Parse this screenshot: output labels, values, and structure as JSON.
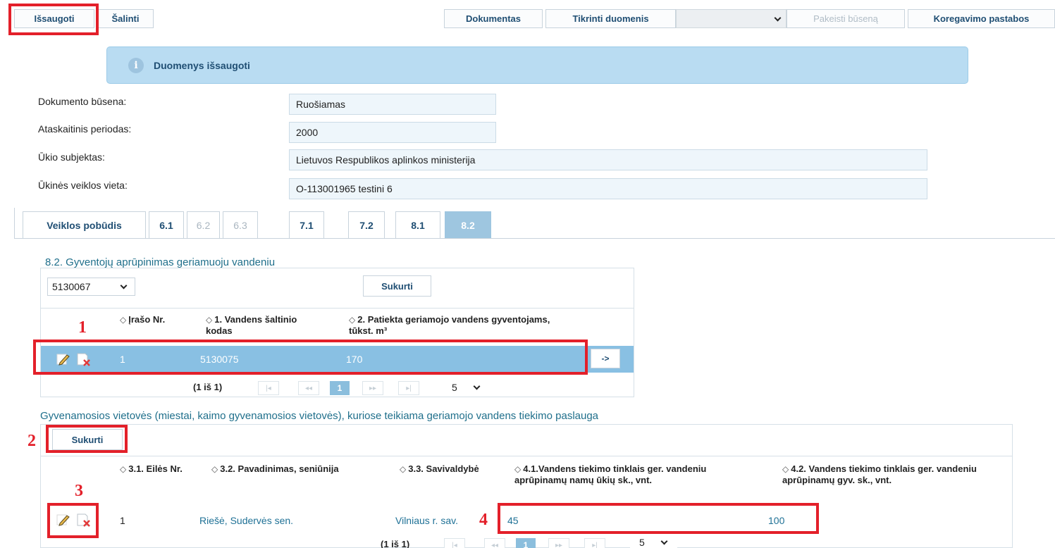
{
  "toolbar": {
    "save": "Išsaugoti",
    "delete": "Šalinti",
    "document": "Dokumentas",
    "check_data": "Tikrinti duomenis",
    "status_select": "",
    "change_status": "Pakeisti būseną",
    "correction_notes": "Koregavimo pastabos"
  },
  "message": "Duomenys išsaugoti",
  "fields": [
    {
      "label": "Dokumento būsena:",
      "value": "Ruošiamas"
    },
    {
      "label": "Ataskaitinis periodas:",
      "value": "2000"
    },
    {
      "label": "Ūkio subjektas:",
      "value": "Lietuvos Respublikos aplinkos ministerija"
    },
    {
      "label": "Ūkinės veiklos vieta:",
      "value": "O-113001965 testini 6"
    }
  ],
  "tabs": [
    "Veiklos pobūdis",
    "6.1",
    "6.2",
    "6.3",
    "7.1",
    "7.2",
    "8.1",
    "8.2"
  ],
  "section1": {
    "title": "8.2. Gyventojų aprūpinimas geriamuoju vandeniu",
    "select_value": "5130067",
    "create_label": "Sukurti",
    "headers": [
      "Įrašo Nr.",
      "1. Vandens šaltinio kodas",
      "2. Patiekta geriamojo vandens gyventojams, tūkst. m³"
    ],
    "row": [
      "1",
      "5130075",
      "170"
    ],
    "arrow": "->",
    "pager": {
      "text": "(1 iš 1)",
      "page": "1",
      "size": "5"
    }
  },
  "section2": {
    "title": "Gyvenamosios vietovės (miestai, kaimo gyvenamosios vietovės), kuriose teikiama geriamojo vandens tiekimo paslauga",
    "create_label": "Sukurti",
    "headers": [
      "3.1. Eilės Nr.",
      "3.2. Pavadinimas, seniūnija",
      "3.3. Savivaldybė",
      "4.1.Vandens tiekimo tinklais ger. vandeniu aprūpinamų namų ūkių sk., vnt.",
      "4.2. Vandens tiekimo tinklais ger. vandeniu aprūpinamų gyv. sk., vnt."
    ],
    "row": [
      "1",
      "Riešė, Sudervės sen.",
      "Vilniaus r. sav.",
      "45",
      "100"
    ],
    "pager": {
      "text": "(1 iš 1)",
      "page": "1",
      "size": "5"
    }
  },
  "annotations": [
    "1",
    "2",
    "3",
    "4"
  ],
  "pager_icons": [
    "|◂",
    "◂◂",
    "▸▸",
    "▸|"
  ]
}
